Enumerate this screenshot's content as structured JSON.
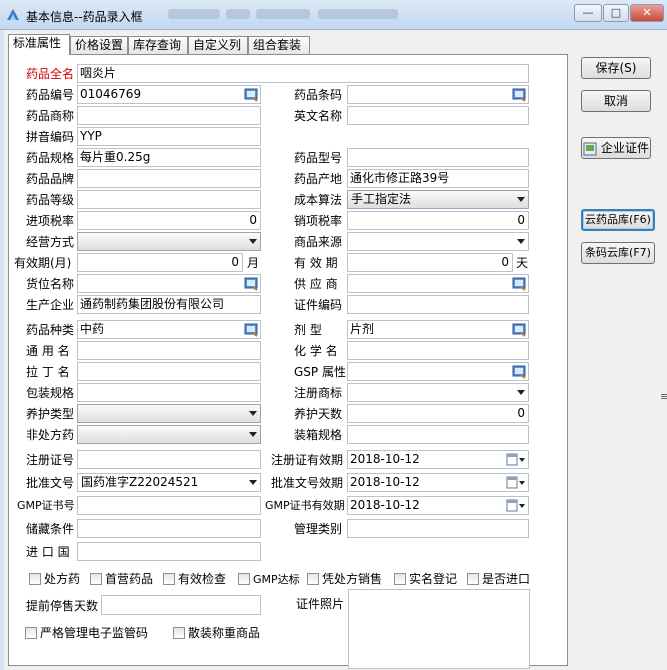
{
  "window": {
    "title": "基本信息--药品录入框"
  },
  "tabs": [
    "标准属性",
    "价格设置",
    "库存查询",
    "自定义列",
    "组合套装"
  ],
  "fields": {
    "full_name": {
      "label": "药品全名",
      "value": "咽炎片"
    },
    "code": {
      "label": "药品编号",
      "value": "01046769"
    },
    "barcode": {
      "label": "药品条码",
      "value": ""
    },
    "trade_name": {
      "label": "药品商称",
      "value": ""
    },
    "english_name": {
      "label": "英文名称",
      "value": ""
    },
    "pinyin": {
      "label": "拼音编码",
      "value": "YYP"
    },
    "spec": {
      "label": "药品规格",
      "value": "每片重0.25g"
    },
    "model": {
      "label": "药品型号",
      "value": ""
    },
    "brand": {
      "label": "药品品牌",
      "value": ""
    },
    "origin": {
      "label": "药品产地",
      "value": "通化市修正路39号"
    },
    "grade": {
      "label": "药品等级",
      "value": ""
    },
    "cost_method": {
      "label": "成本算法",
      "value": "手工指定法"
    },
    "input_tax": {
      "label": "进项税率",
      "value": "0"
    },
    "output_tax": {
      "label": "销项税率",
      "value": "0"
    },
    "business_mode": {
      "label": "经营方式",
      "value": ""
    },
    "source": {
      "label": "商品来源",
      "value": ""
    },
    "shelf_life_months": {
      "label": "有效期(月)",
      "value": "0",
      "unit": "月"
    },
    "validity": {
      "label": "有 效 期",
      "value": "0",
      "unit": "天"
    },
    "location": {
      "label": "货位名称",
      "value": ""
    },
    "supplier": {
      "label": "供 应 商",
      "value": ""
    },
    "manufacturer": {
      "label": "生产企业",
      "value": "通药制药集团股份有限公司"
    },
    "cert_code": {
      "label": "证件编码",
      "value": ""
    },
    "category": {
      "label": "药品种类",
      "value": "中药"
    },
    "dosage_form": {
      "label": "剂    型",
      "value": "片剂"
    },
    "generic_name": {
      "label": "通 用 名",
      "value": ""
    },
    "chemical_name": {
      "label": "化 学 名",
      "value": ""
    },
    "latin_name": {
      "label": "拉 丁 名",
      "value": ""
    },
    "gsp": {
      "label": "GSP 属性",
      "value": ""
    },
    "package_spec": {
      "label": "包装规格",
      "value": ""
    },
    "reg_trademark": {
      "label": "注册商标",
      "value": ""
    },
    "care_type": {
      "label": "养护类型",
      "value": ""
    },
    "care_days": {
      "label": "养护天数",
      "value": "0"
    },
    "otc": {
      "label": "非处方药",
      "value": ""
    },
    "box_spec": {
      "label": "装箱规格",
      "value": ""
    },
    "reg_cert": {
      "label": "注册证号",
      "value": ""
    },
    "reg_cert_expiry": {
      "label": "注册证有效期",
      "value": "2018-10-12"
    },
    "approval_no": {
      "label": "批准文号",
      "value": "国药准字Z22024521"
    },
    "approval_expiry": {
      "label": "批准文号效期",
      "value": "2018-10-12"
    },
    "gmp_no": {
      "label": "GMP证书号",
      "value": ""
    },
    "gmp_expiry": {
      "label": "GMP证书有效期",
      "value": "2018-10-12"
    },
    "storage": {
      "label": "储藏条件",
      "value": ""
    },
    "mgmt_category": {
      "label": "管理类别",
      "value": ""
    },
    "import_country": {
      "label": "进 口 国",
      "value": ""
    },
    "stop_days": {
      "label": "提前停售天数",
      "value": ""
    },
    "cert_photo": {
      "label": "证件照片"
    }
  },
  "checkboxes": {
    "row1": [
      "处方药",
      "首营药品",
      "有效检查",
      "GMP达标",
      "凭处方销售",
      "实名登记",
      "是否进口"
    ],
    "strict": "严格管理电子监管码",
    "bulk": "散装称重商品"
  },
  "buttons": {
    "save": "保存(S)",
    "cancel": "取消",
    "enterprise_cert": "企业证件",
    "cloud_drug": "云药品库(F6)",
    "barcode_cloud": "条码云库(F7)"
  },
  "colors": {
    "required_label": "#d00000",
    "focus_border": "#3c7fb1"
  }
}
